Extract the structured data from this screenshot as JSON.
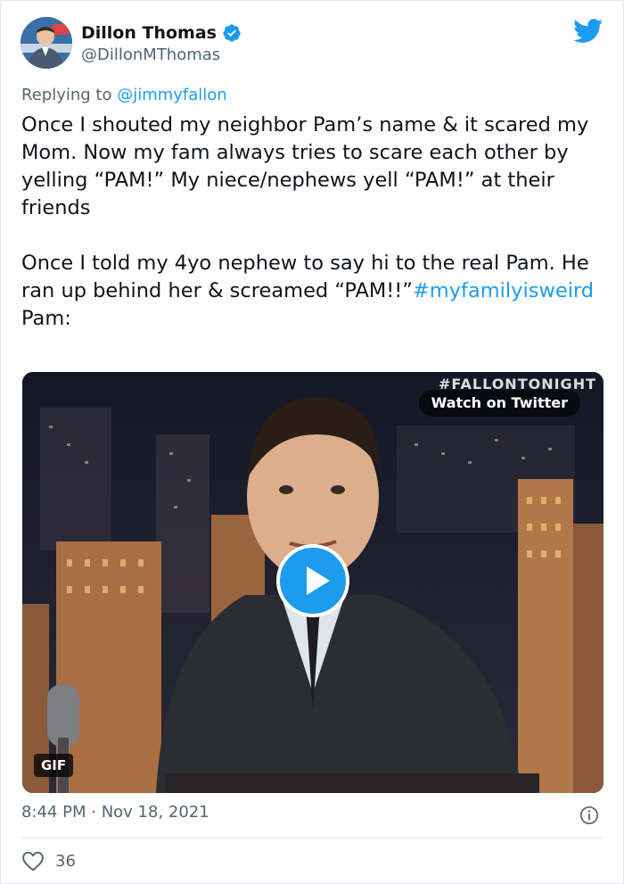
{
  "author": {
    "name": "Dillon Thomas",
    "handle": "@DillonMThomas"
  },
  "reply": {
    "prefix": "Replying to ",
    "to": "@jimmyfallon"
  },
  "tweet": {
    "para1": "Once I shouted my neighbor Pam’s name & it scared my Mom. Now my fam always tries to scare each other by yelling “PAM!” My niece/nephews yell “PAM!” at their friends",
    "para2_text": "Once I told my 4yo nephew to say hi to the real Pam. He ran up behind her & screamed “PAM!!”",
    "hashtag": "#myfamilyisweird",
    "para3": "Pam:"
  },
  "media": {
    "watch_label": "Watch on Twitter",
    "overlay_text": "#FALLONTONIGHT",
    "gif_badge": "GIF"
  },
  "meta": {
    "timestamp": "8:44 PM · Nov 18, 2021",
    "like_count": "36"
  },
  "colors": {
    "accent": "#1d9bf0",
    "secondary_text": "#536471"
  },
  "icons": [
    "verified-badge-icon",
    "twitter-bird-icon",
    "play-icon",
    "info-icon",
    "heart-icon"
  ]
}
